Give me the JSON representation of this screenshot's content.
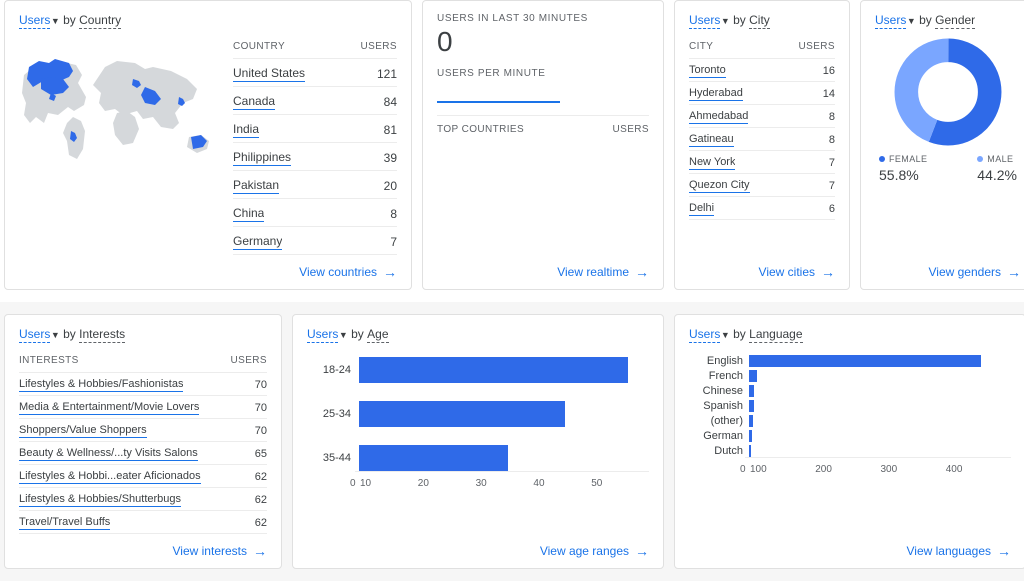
{
  "labels": {
    "metric": "Users",
    "by": "by",
    "users_header": "USERS"
  },
  "country_card": {
    "dimension": "Country",
    "table_dim_header": "COUNTRY",
    "rows": [
      {
        "name": "United States",
        "value": 121
      },
      {
        "name": "Canada",
        "value": 84
      },
      {
        "name": "India",
        "value": 81
      },
      {
        "name": "Philippines",
        "value": 39
      },
      {
        "name": "Pakistan",
        "value": 20
      },
      {
        "name": "China",
        "value": 8
      },
      {
        "name": "Germany",
        "value": 7
      }
    ],
    "link": "View countries"
  },
  "realtime_card": {
    "label_30min": "USERS IN LAST 30 MINUTES",
    "count": "0",
    "label_per_min": "USERS PER MINUTE",
    "top_countries": "TOP COUNTRIES",
    "top_users": "USERS",
    "link": "View realtime"
  },
  "city_card": {
    "dimension": "City",
    "table_dim_header": "CITY",
    "rows": [
      {
        "name": "Toronto",
        "value": 16
      },
      {
        "name": "Hyderabad",
        "value": 14
      },
      {
        "name": "Ahmedabad",
        "value": 8
      },
      {
        "name": "Gatineau",
        "value": 8
      },
      {
        "name": "New York",
        "value": 7
      },
      {
        "name": "Quezon City",
        "value": 7
      },
      {
        "name": "Delhi",
        "value": 6
      }
    ],
    "link": "View cities"
  },
  "gender_card": {
    "dimension": "Gender",
    "legend": {
      "female_label": "FEMALE",
      "female_value": "55.8%",
      "male_label": "MALE",
      "male_value": "44.2%"
    },
    "link": "View genders"
  },
  "interests_card": {
    "dimension": "Interests",
    "table_dim_header": "INTERESTS",
    "rows": [
      {
        "name": "Lifestyles & Hobbies/Fashionistas",
        "value": 70
      },
      {
        "name": "Media & Entertainment/Movie Lovers",
        "value": 70
      },
      {
        "name": "Shoppers/Value Shoppers",
        "value": 70
      },
      {
        "name": "Beauty & Wellness/...ty Visits Salons",
        "value": 65
      },
      {
        "name": "Lifestyles & Hobbi...eater Aficionados",
        "value": 62
      },
      {
        "name": "Lifestyles & Hobbies/Shutterbugs",
        "value": 62
      },
      {
        "name": "Travel/Travel Buffs",
        "value": 62
      }
    ],
    "link": "View interests"
  },
  "age_card": {
    "dimension": "Age",
    "link": "View age ranges"
  },
  "language_card": {
    "dimension": "Language",
    "link": "View languages"
  },
  "chart_data": [
    {
      "id": "gender_donut",
      "type": "pie",
      "title": "Users by Gender",
      "series": [
        {
          "name": "Female",
          "value": 55.8,
          "color": "#2f6ae8"
        },
        {
          "name": "Male",
          "value": 44.2,
          "color": "#5f94ff"
        }
      ]
    },
    {
      "id": "age_bar",
      "type": "bar",
      "orientation": "horizontal",
      "title": "Users by Age",
      "categories": [
        "18-24",
        "25-34",
        "35-44"
      ],
      "values": [
        47,
        36,
        26
      ],
      "xlabel": "",
      "ylabel": "",
      "xlim": [
        0,
        50
      ],
      "xticks": [
        0,
        10,
        20,
        30,
        40,
        50
      ]
    },
    {
      "id": "language_bar",
      "type": "bar",
      "orientation": "horizontal",
      "title": "Users by Language",
      "categories": [
        "English",
        "French",
        "Chinese",
        "Spanish",
        "(other)",
        "German",
        "Dutch"
      ],
      "values": [
        360,
        12,
        8,
        8,
        6,
        4,
        3
      ],
      "xlim": [
        0,
        400
      ],
      "xticks": [
        0,
        100,
        200,
        300,
        400
      ]
    }
  ]
}
